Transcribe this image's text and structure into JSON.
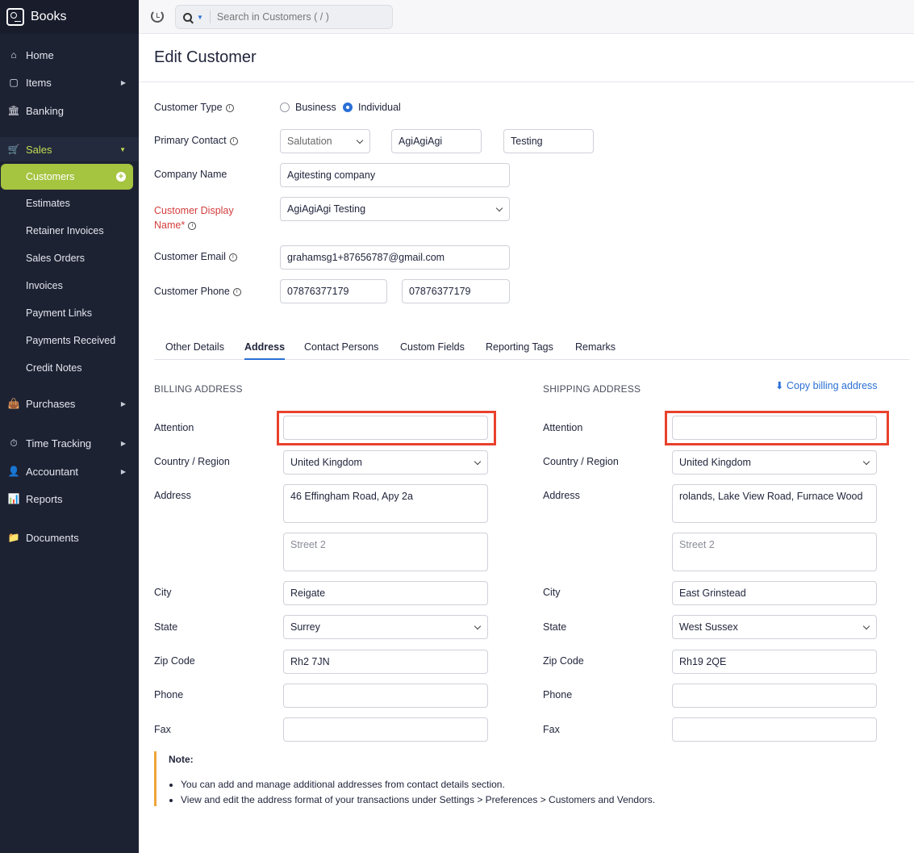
{
  "app": {
    "name": "Books"
  },
  "sidebar": {
    "home": "Home",
    "items": "Items",
    "banking": "Banking",
    "sales": "Sales",
    "sales_items": [
      "Customers",
      "Estimates",
      "Retainer Invoices",
      "Sales Orders",
      "Invoices",
      "Payment Links",
      "Payments Received",
      "Credit Notes"
    ],
    "purchases": "Purchases",
    "time_tracking": "Time Tracking",
    "accountant": "Accountant",
    "reports": "Reports",
    "documents": "Documents"
  },
  "topbar": {
    "search_placeholder": "Search in Customers ( / )"
  },
  "page": {
    "title": "Edit Customer"
  },
  "form": {
    "customer_type_label": "Customer Type",
    "type_business": "Business",
    "type_individual": "Individual",
    "selected_type": "Individual",
    "primary_contact_label": "Primary Contact",
    "salutation": "Salutation",
    "first_name": "AgiAgiAgi",
    "last_name": "Testing",
    "company_name_label": "Company Name",
    "company_name": "Agitesting company",
    "display_name_label_1": "Customer Display",
    "display_name_label_2": "Name*",
    "display_name": "AgiAgiAgi Testing",
    "email_label": "Customer Email",
    "email": "grahamsg1+87656787@gmail.com",
    "phone_label": "Customer Phone",
    "work_phone": "07876377179",
    "mobile_phone": "07876377179"
  },
  "tabs": [
    "Other Details",
    "Address",
    "Contact Persons",
    "Custom Fields",
    "Reporting Tags",
    "Remarks"
  ],
  "active_tab": "Address",
  "address_labels": {
    "attention": "Attention",
    "country": "Country / Region",
    "address": "Address",
    "city": "City",
    "state": "State",
    "zip": "Zip Code",
    "phone": "Phone",
    "fax": "Fax",
    "street2_placeholder": "Street 2"
  },
  "billing": {
    "heading": "BILLING ADDRESS",
    "attention": "",
    "country": "United Kingdom",
    "street1": "46 Effingham Road, Apy 2a",
    "city": "Reigate",
    "state": "Surrey",
    "zip": "Rh2 7JN",
    "phone": "",
    "fax": ""
  },
  "shipping": {
    "heading": "SHIPPING ADDRESS",
    "copy_link": "Copy billing address",
    "attention": "",
    "country": "United Kingdom",
    "street1": "rolands, Lake View Road, Furnace Wood",
    "city": "East Grinstead",
    "state": "West Sussex",
    "zip": "Rh19 2QE",
    "phone": "",
    "fax": ""
  },
  "note": {
    "title": "Note:",
    "items": [
      "You can add and manage additional addresses from contact details section.",
      "View and edit the address format of your transactions under Settings > Preferences > Customers and Vendors."
    ]
  },
  "colors": {
    "sidebar": "#1d2233",
    "accent_green": "#a5c440",
    "link_blue": "#2a6fd6",
    "highlight_red": "#e8412c",
    "required_red": "#d43d3d"
  }
}
